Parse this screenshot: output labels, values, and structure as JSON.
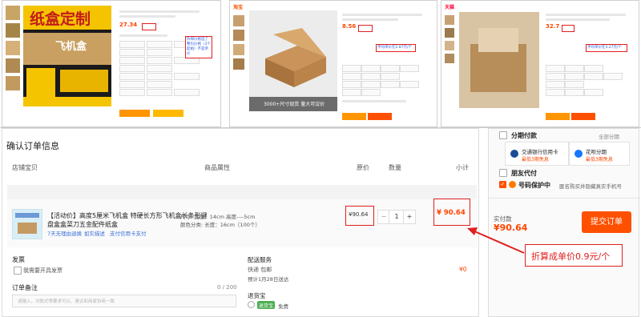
{
  "thumbs": [
    {
      "store_tag": "",
      "banner": "纸盒定制",
      "sub_banner": "飞机盒",
      "price": "27.34",
      "note": "阶梯价格选了整包价格（3个起拍）不是单价"
    },
    {
      "store_tag": "淘宝",
      "price": "8.56",
      "note": "平均单价在2.87元/个",
      "caption": "3000+尺寸现货 量大可议价"
    },
    {
      "store_tag": "天猫",
      "price": "32.7",
      "note": "平均单价在3.27元/个"
    }
  ],
  "order": {
    "title": "确认订单信息",
    "col_shop": "店铺宝贝",
    "col_attr": "商品属性",
    "col_price": "原价",
    "col_qty": "数量",
    "col_subtotal": "小计",
    "item_title_1": "【活动价】高度5厘米飞机盒 特硬长方形飞机盒长条形键",
    "item_title_2": "盘盒盒菜刀五金配件纸盒",
    "service_1": "7天无理由退换",
    "service_2": "如实描述",
    "service_3": "支付信用卡支付",
    "attr_1": "尺寸: 宽度：14cm 高度----5cm",
    "attr_2": "颜色分类: 长度：16cm（100个）",
    "price": "¥90.64",
    "qty": "1",
    "qty_minus": "−",
    "qty_plus": "+",
    "subtotal": "¥ 90.64",
    "invoice_label": "发票",
    "invoice_option": "我需要开具发票",
    "remark_label": "订单备注",
    "remark_count": "0 / 200",
    "remark_placeholder": "请输入，对款式等要求可以、建议和商家协商一致",
    "delivery_label": "配送服务",
    "delivery_method": "快递 包邮",
    "delivery_eta": "预计1月28日送达",
    "delivery_fee": "¥0",
    "return_label": "退货宝",
    "return_tag": "退货宝",
    "return_value": "免费"
  },
  "annotation": "折算成单价0.9元/个",
  "sidebar": {
    "installment": "分期付款",
    "installment_right": "全部分期",
    "bank_card": "交通银行信用卡",
    "bank_card_note": "最低3期免息",
    "huabei": "花呗分期",
    "huabei_note": "最低3期免息",
    "friend_pay": "朋友代付",
    "privacy": "号码保护中",
    "privacy_right": "匿名购买并隐藏真实手机号",
    "paid_label": "实付款",
    "paid_amount": "¥90.64",
    "submit": "提交订单"
  },
  "colors": {
    "accent": "#ff5000",
    "price": "#ff4400",
    "annotation": "#e02020"
  }
}
